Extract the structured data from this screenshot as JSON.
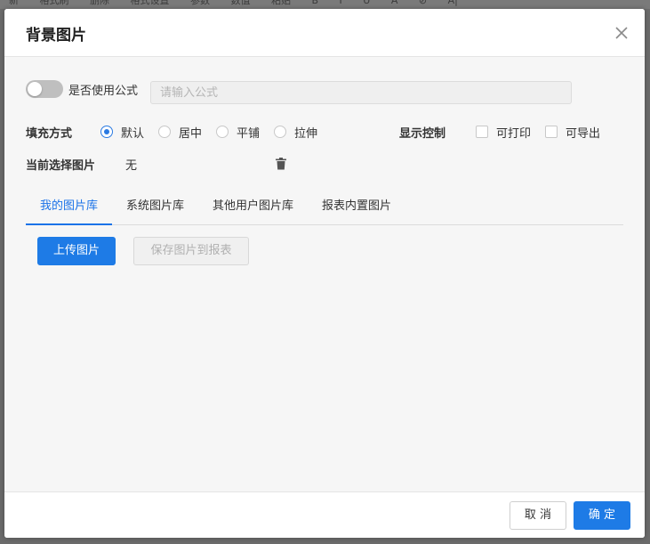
{
  "background_toolbar": {
    "items": [
      "新",
      "格式刷",
      "删除",
      "格式设置",
      "参数",
      "数值",
      "粘贴",
      "B",
      "I",
      "U",
      "A",
      "⊘",
      "A|"
    ]
  },
  "dialog": {
    "title": "背景图片",
    "formula_toggle": {
      "label": "是否使用公式",
      "enabled": false
    },
    "formula_input": {
      "placeholder": "请输入公式",
      "value": ""
    },
    "fill_mode": {
      "label": "填充方式",
      "options": [
        "默认",
        "居中",
        "平铺",
        "拉伸"
      ],
      "selected": "默认"
    },
    "display_control": {
      "label": "显示控制",
      "options": [
        {
          "label": "可打印",
          "checked": false
        },
        {
          "label": "可导出",
          "checked": false
        }
      ]
    },
    "current_image": {
      "label": "当前选择图片",
      "value": "无"
    },
    "tabs": [
      "我的图片库",
      "系统图片库",
      "其他用户图片库",
      "报表内置图片"
    ],
    "active_tab": "我的图片库",
    "upload_button": "上传图片",
    "save_to_report_button": "保存图片到报表",
    "cancel_button": "取 消",
    "ok_button": "确 定"
  },
  "colors": {
    "accent": "#1e7be6",
    "overlay": "#6b6b6b"
  }
}
